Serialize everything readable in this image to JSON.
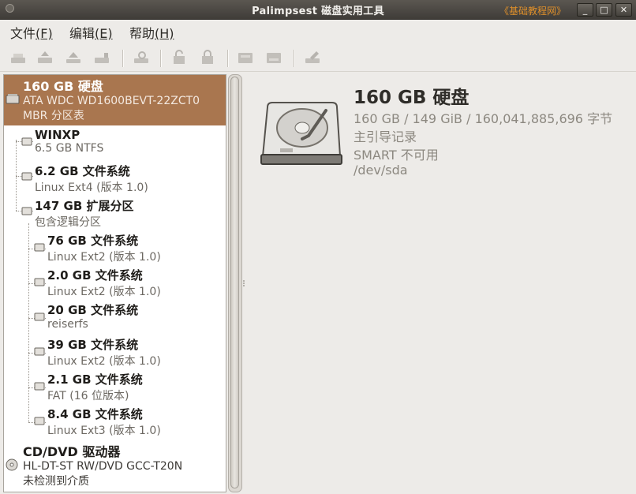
{
  "window": {
    "title": "Palimpsest 磁盘实用工具",
    "watermark": "《基础教程网》",
    "buttons": {
      "minimize": "_",
      "maximize": "□",
      "close": "✕"
    }
  },
  "menu": [
    {
      "label": "文件",
      "mnemonic": "(F)"
    },
    {
      "label": "编辑",
      "mnemonic": "(E)"
    },
    {
      "label": "帮助",
      "mnemonic": "(H)"
    }
  ],
  "toolbar_icons": [
    "mount-icon",
    "unmount-icon",
    "eject-icon",
    "detach-icon",
    "check-filesystem-icon",
    "unlock-icon",
    "lock-icon",
    "format-drive-icon",
    "format-volume-icon",
    "edit-partition-icon"
  ],
  "tree": {
    "disk": {
      "title": "160 GB 硬盘",
      "line1": "ATA WDC WD1600BEVT-22ZCT0",
      "line2": "MBR 分区表"
    },
    "partitions": [
      {
        "title": "WINXP",
        "subtitle": "6.5 GB NTFS"
      },
      {
        "title": "6.2 GB 文件系统",
        "subtitle": "Linux Ext4 (版本 1.0)"
      },
      {
        "title": "147 GB 扩展分区",
        "subtitle": "包含逻辑分区"
      }
    ],
    "logical": [
      {
        "title": "76 GB 文件系统",
        "subtitle": "Linux Ext2 (版本 1.0)"
      },
      {
        "title": "2.0 GB 文件系统",
        "subtitle": "Linux Ext2 (版本 1.0)"
      },
      {
        "title": "20 GB 文件系统",
        "subtitle": "reiserfs"
      },
      {
        "title": "39 GB 文件系统",
        "subtitle": "Linux Ext2 (版本 1.0)"
      },
      {
        "title": "2.1 GB 文件系统",
        "subtitle": "FAT (16 位版本)"
      },
      {
        "title": "8.4 GB 文件系统",
        "subtitle": "Linux Ext3 (版本 1.0)"
      }
    ],
    "cdrom": {
      "title": "CD/DVD 驱动器",
      "line1": "HL-DT-ST RW/DVD GCC-T20N",
      "line2": "未检测到介质"
    }
  },
  "details": {
    "title": "160 GB 硬盘",
    "size": "160 GB / 149 GiB / 160,041,885,696 字节",
    "partitioning": "主引导记录",
    "smart": "SMART 不可用",
    "device": "/dev/sda"
  },
  "colors": {
    "selection": "#a9764f",
    "accent_watermark": "#e0902a",
    "titlebar": "#3f3c38"
  }
}
